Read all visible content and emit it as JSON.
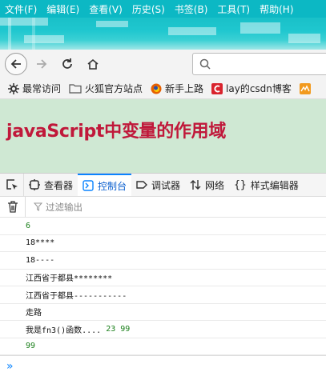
{
  "menu": [
    "文件(F)",
    "编辑(E)",
    "查看(V)",
    "历史(S)",
    "书签(B)",
    "工具(T)",
    "帮助(H)"
  ],
  "bookmarks": [
    {
      "label": "最常访问",
      "icon": "gear-icon"
    },
    {
      "label": "火狐官方站点",
      "icon": "folder-icon"
    },
    {
      "label": "新手上路",
      "icon": "firefox-icon"
    },
    {
      "label": "lay的csdn博客",
      "icon": "csdn-icon"
    }
  ],
  "page": {
    "heading": "javaScript中变量的作用域"
  },
  "devtools": {
    "tabs": [
      "查看器",
      "控制台",
      "调试器",
      "网络",
      "样式编辑器"
    ],
    "active_tab": "控制台",
    "filter_placeholder": "过滤输出"
  },
  "console": {
    "rows": [
      {
        "text": "",
        "num": "6"
      },
      {
        "text": "18****",
        "num": ""
      },
      {
        "text": "18----",
        "num": ""
      },
      {
        "text": "江西省于都县********",
        "num": ""
      },
      {
        "text": "江西省于都县-----------",
        "num": ""
      },
      {
        "text": "走路",
        "num": ""
      },
      {
        "text": "我是fn3()函数.... ",
        "num": "23 99"
      },
      {
        "text": "",
        "num": "99"
      }
    ],
    "prompt": "»"
  },
  "colors": {
    "menubar": "#0cb8c4",
    "page_bg": "#cfe8d3",
    "heading": "#c0183a",
    "active_tab": "#0a84ff",
    "number": "#1a7f1a"
  }
}
